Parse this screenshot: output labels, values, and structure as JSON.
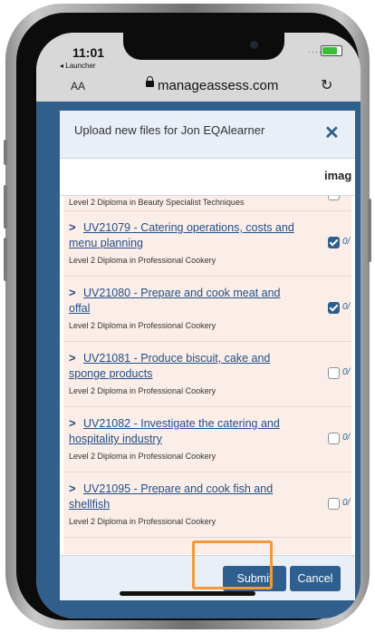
{
  "status_bar": {
    "time": "11:01",
    "back_label": "◂ Launcher",
    "signal": "····"
  },
  "browser": {
    "text_size_label": "AA",
    "url": "manageassess.com",
    "reload_icon": "reload-icon"
  },
  "modal": {
    "title": "Upload new files for Jon EQAlearner",
    "close_icon": "close-icon",
    "column_header": "imag",
    "partial_row": {
      "qualification": "Level 2 Diploma in Beauty Specialist Techniques"
    },
    "units": [
      {
        "label": "UV21079 - Catering operations, costs and menu planning",
        "qualification": "Level 2 Diploma in Professional Cookery",
        "checked": true,
        "count": "0/"
      },
      {
        "label": "UV21080 - Prepare and cook meat and offal",
        "qualification": "Level 2 Diploma in Professional Cookery",
        "checked": true,
        "count": "0/"
      },
      {
        "label": "UV21081 - Produce biscuit, cake and sponge products",
        "qualification": "Level 2 Diploma in Professional Cookery",
        "checked": false,
        "count": "0/"
      },
      {
        "label": "UV21082 - Investigate the catering and hospitality industry",
        "qualification": "Level 2 Diploma in Professional Cookery",
        "checked": false,
        "count": "0/"
      },
      {
        "label": "UV21095 - Prepare and cook fish and shellfish",
        "qualification": "Level 2 Diploma in Professional Cookery",
        "checked": false,
        "count": "0/"
      }
    ],
    "submit_label": "Submit",
    "cancel_label": "Cancel"
  },
  "colors": {
    "primary": "#2e5f8f",
    "highlight": "#f09a3c",
    "row_bg": "#fbeee9"
  }
}
